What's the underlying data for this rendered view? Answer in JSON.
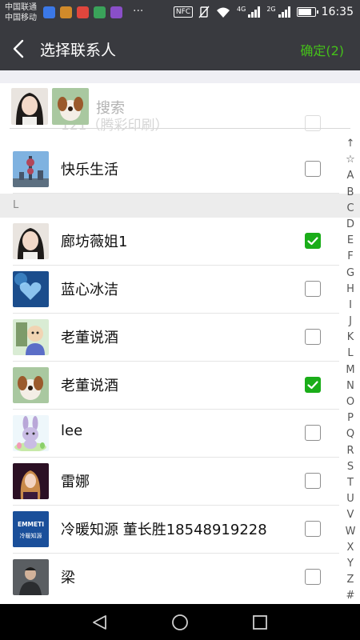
{
  "status_bar": {
    "carrier_1": "中国联通",
    "carrier_2": "中国移动",
    "more": "···",
    "nfc": "NFC",
    "net_1": "4G",
    "net_2": "2G",
    "battery_level": 0.85,
    "time": "16:35"
  },
  "header": {
    "title": "选择联系人",
    "confirm_label": "确定(2)",
    "accent_color": "#45c01a"
  },
  "search": {
    "placeholder": "搜索",
    "selected_avatars": [
      "avatar-girl-photo",
      "avatar-dog-photo"
    ],
    "hidden_row_name": "121（腾彩印刷）"
  },
  "contacts": [
    {
      "name": "快乐生活",
      "checked": false,
      "avatar": "tower-photo"
    },
    {
      "name": "廊坊薇姐1",
      "checked": true,
      "avatar": "girl-photo"
    },
    {
      "name": "蓝心冰洁",
      "checked": false,
      "avatar": "blue-heart-photo"
    },
    {
      "name": "老董说酒",
      "checked": false,
      "avatar": "cartoon-photo"
    },
    {
      "name": "老董说酒",
      "checked": true,
      "avatar": "dog-photo"
    },
    {
      "name": "lee",
      "checked": false,
      "avatar": "bunny-cartoon"
    },
    {
      "name": "雷娜",
      "checked": false,
      "avatar": "woman-photo"
    },
    {
      "name": "冷暖知源 董长胜18548919228",
      "checked": false,
      "avatar": "emmeti-logo"
    },
    {
      "name": "梁",
      "checked": false,
      "avatar": "man-photo"
    }
  ],
  "section_header": "L",
  "emmeti_logo": {
    "brand": "EMMETI",
    "sub": "冷暖知源"
  },
  "index_letters": [
    "↑",
    "☆",
    "A",
    "B",
    "C",
    "D",
    "E",
    "F",
    "G",
    "H",
    "I",
    "J",
    "K",
    "L",
    "M",
    "N",
    "O",
    "P",
    "Q",
    "R",
    "S",
    "T",
    "U",
    "V",
    "W",
    "X",
    "Y",
    "Z",
    "#"
  ],
  "nav": [
    "back-icon",
    "home-icon",
    "recents-icon"
  ]
}
